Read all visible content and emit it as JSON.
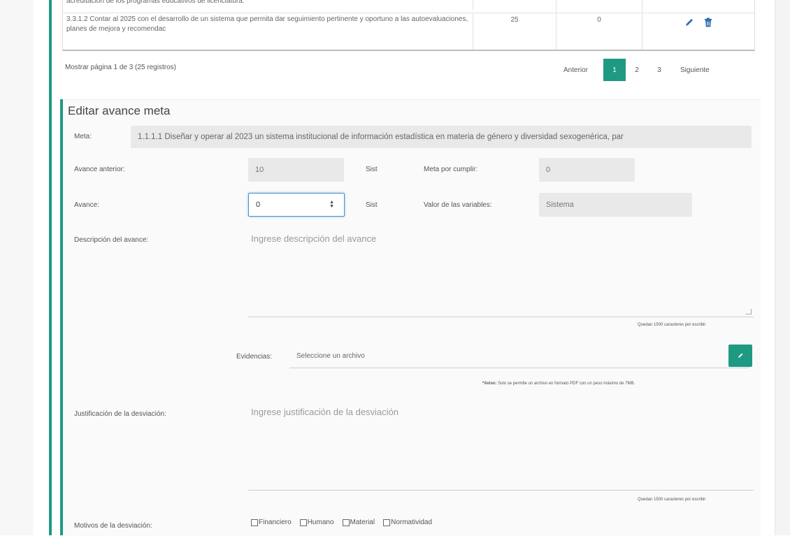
{
  "table": {
    "rows": [
      {
        "description": "acreditación de los programas educativos de licenciatura.",
        "value1": "",
        "value2": ""
      },
      {
        "description": "3.3.1.2 Contar al 2025 con el desarrollo de un sistema que permita dar seguimiento pertinente y oportuno a las autoevaluaciones, planes de mejora y recomendac",
        "value1": "25",
        "value2": "0"
      }
    ]
  },
  "pagination": {
    "info": "Mostrar página 1 de 3 (25 registros)",
    "prev_label": "Anterior",
    "pages": [
      "1",
      "2",
      "3"
    ],
    "active_page": "1",
    "next_label": "Siguiente"
  },
  "form": {
    "title": "Editar avance meta",
    "meta_label": "Meta:",
    "meta_value": "1.1.1.1 Diseñar y operar al 2023 un sistema institucional de información estadística en materia de género y diversidad sexogenérica, par",
    "avance_anterior_label": "Avance anterior:",
    "avance_anterior_value": "10",
    "unit1": "Sist",
    "meta_por_cumplir_label": "Meta por cumplir:",
    "meta_por_cumplir_value": "0",
    "avance_label": "Avance:",
    "avance_value": "0",
    "unit2": "Sist",
    "valor_variables_label": "Valor de las variables:",
    "valor_variables_value": "Sistema",
    "descripcion_label": "Descripción del avance:",
    "descripcion_placeholder": "Ingrese descripción del avance",
    "descripcion_counter": "Quedan 1500 caracteres por escribir",
    "evidencias_label": "Evidencias:",
    "evidencias_placeholder": "Seleccione un archivo",
    "aviso_bold": "*Aviso:",
    "aviso_text": " Solo se permite un archivo en formato PDF con un peso máximo de 7MB.",
    "justificacion_label": "Justificación de la desviación:",
    "justificacion_placeholder": "Ingrese justificación de la desviación",
    "justificacion_counter": "Quedan 1500 caracteres por escribir",
    "motivos_label": "Motivos de la desviación:",
    "motivos": [
      "Financiero",
      "Humano",
      "Material",
      "Normatividad"
    ]
  },
  "colors": {
    "accent": "#1f9a82",
    "edit_icon": "#2f6fb0",
    "delete_icon": "#2f6fb0"
  },
  "icons": [
    "pencil-icon",
    "trash-icon",
    "file-browse-icon",
    "spinner-arrows-icon"
  ]
}
